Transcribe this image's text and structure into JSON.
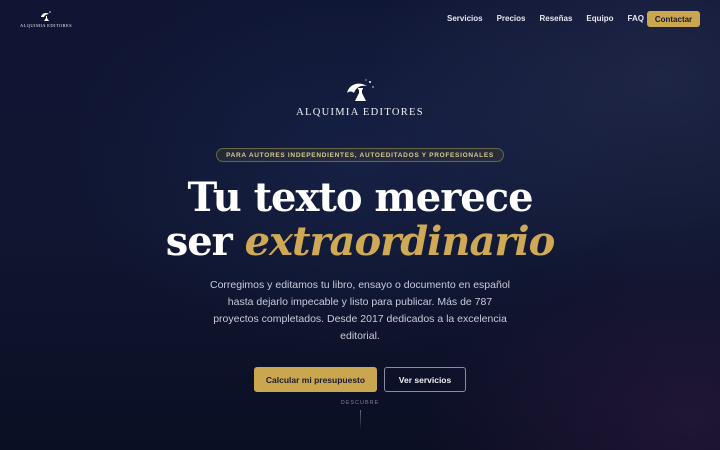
{
  "nav": {
    "logo_text": "ALQUIMIA EDITORES",
    "links": [
      "Servicios",
      "Precios",
      "Reseñas",
      "Equipo",
      "FAQ"
    ],
    "cta": "Contactar"
  },
  "brand": {
    "name": "ALQUIMIA EDITORES"
  },
  "hero": {
    "badge": "PARA AUTORES INDEPENDIENTES, AUTOEDITADOS Y PROFESIONALES",
    "headline_line1": "Tu texto merece",
    "headline_line2_plain": "ser",
    "headline_line2_accent": "extraordinario",
    "lead": "Corregimos y editamos tu libro, ensayo o documento en español hasta dejarlo impecable y listo para publicar. Más de 787 proyectos completados. Desde 2017 dedicados a la excelencia editorial.",
    "primary_button": "Calcular mi presupuesto",
    "secondary_button": "Ver servicios",
    "scroll_label": "DESCUBRE"
  },
  "colors": {
    "accent": "#caa64f",
    "background": "#0f1533"
  }
}
